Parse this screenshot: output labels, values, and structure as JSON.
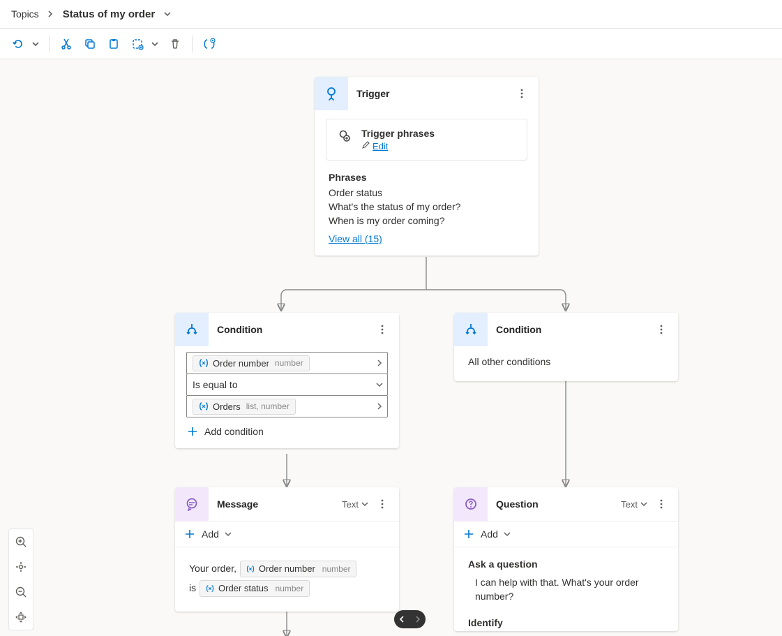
{
  "breadcrumb": {
    "root": "Topics",
    "title": "Status of my order"
  },
  "toolbar": {
    "undo": "Undo",
    "cut": "Cut",
    "copy": "Copy",
    "paste": "Paste",
    "selectAll": "Select all",
    "delete": "Delete",
    "vars": "Variables"
  },
  "trigger": {
    "title": "Trigger",
    "innerTitle": "Trigger phrases",
    "editLabel": "Edit",
    "phrasesHead": "Phrases",
    "phrases": [
      "Order status",
      "What's the status of my order?",
      "When is my order coming?"
    ],
    "viewAll": "View all (15)"
  },
  "condLeft": {
    "title": "Condition",
    "var1Name": "Order number",
    "var1Type": "number",
    "operator": "Is equal to",
    "var2Name": "Orders",
    "var2Type": "list, number",
    "addLabel": "Add condition"
  },
  "condRight": {
    "title": "Condition",
    "body": "All other conditions"
  },
  "message": {
    "title": "Message",
    "typeLabel": "Text",
    "addLabel": "Add",
    "text1": "Your order, ",
    "chip1Name": "Order number",
    "chip1Type": "number",
    "text2": " is ",
    "chip2Name": "Order status",
    "chip2Type": "number"
  },
  "question": {
    "title": "Question",
    "typeLabel": "Text",
    "addLabel": "Add",
    "askHead": "Ask a question",
    "askText": "I can help with that. What's your order number?",
    "identifyHead": "Identify"
  }
}
